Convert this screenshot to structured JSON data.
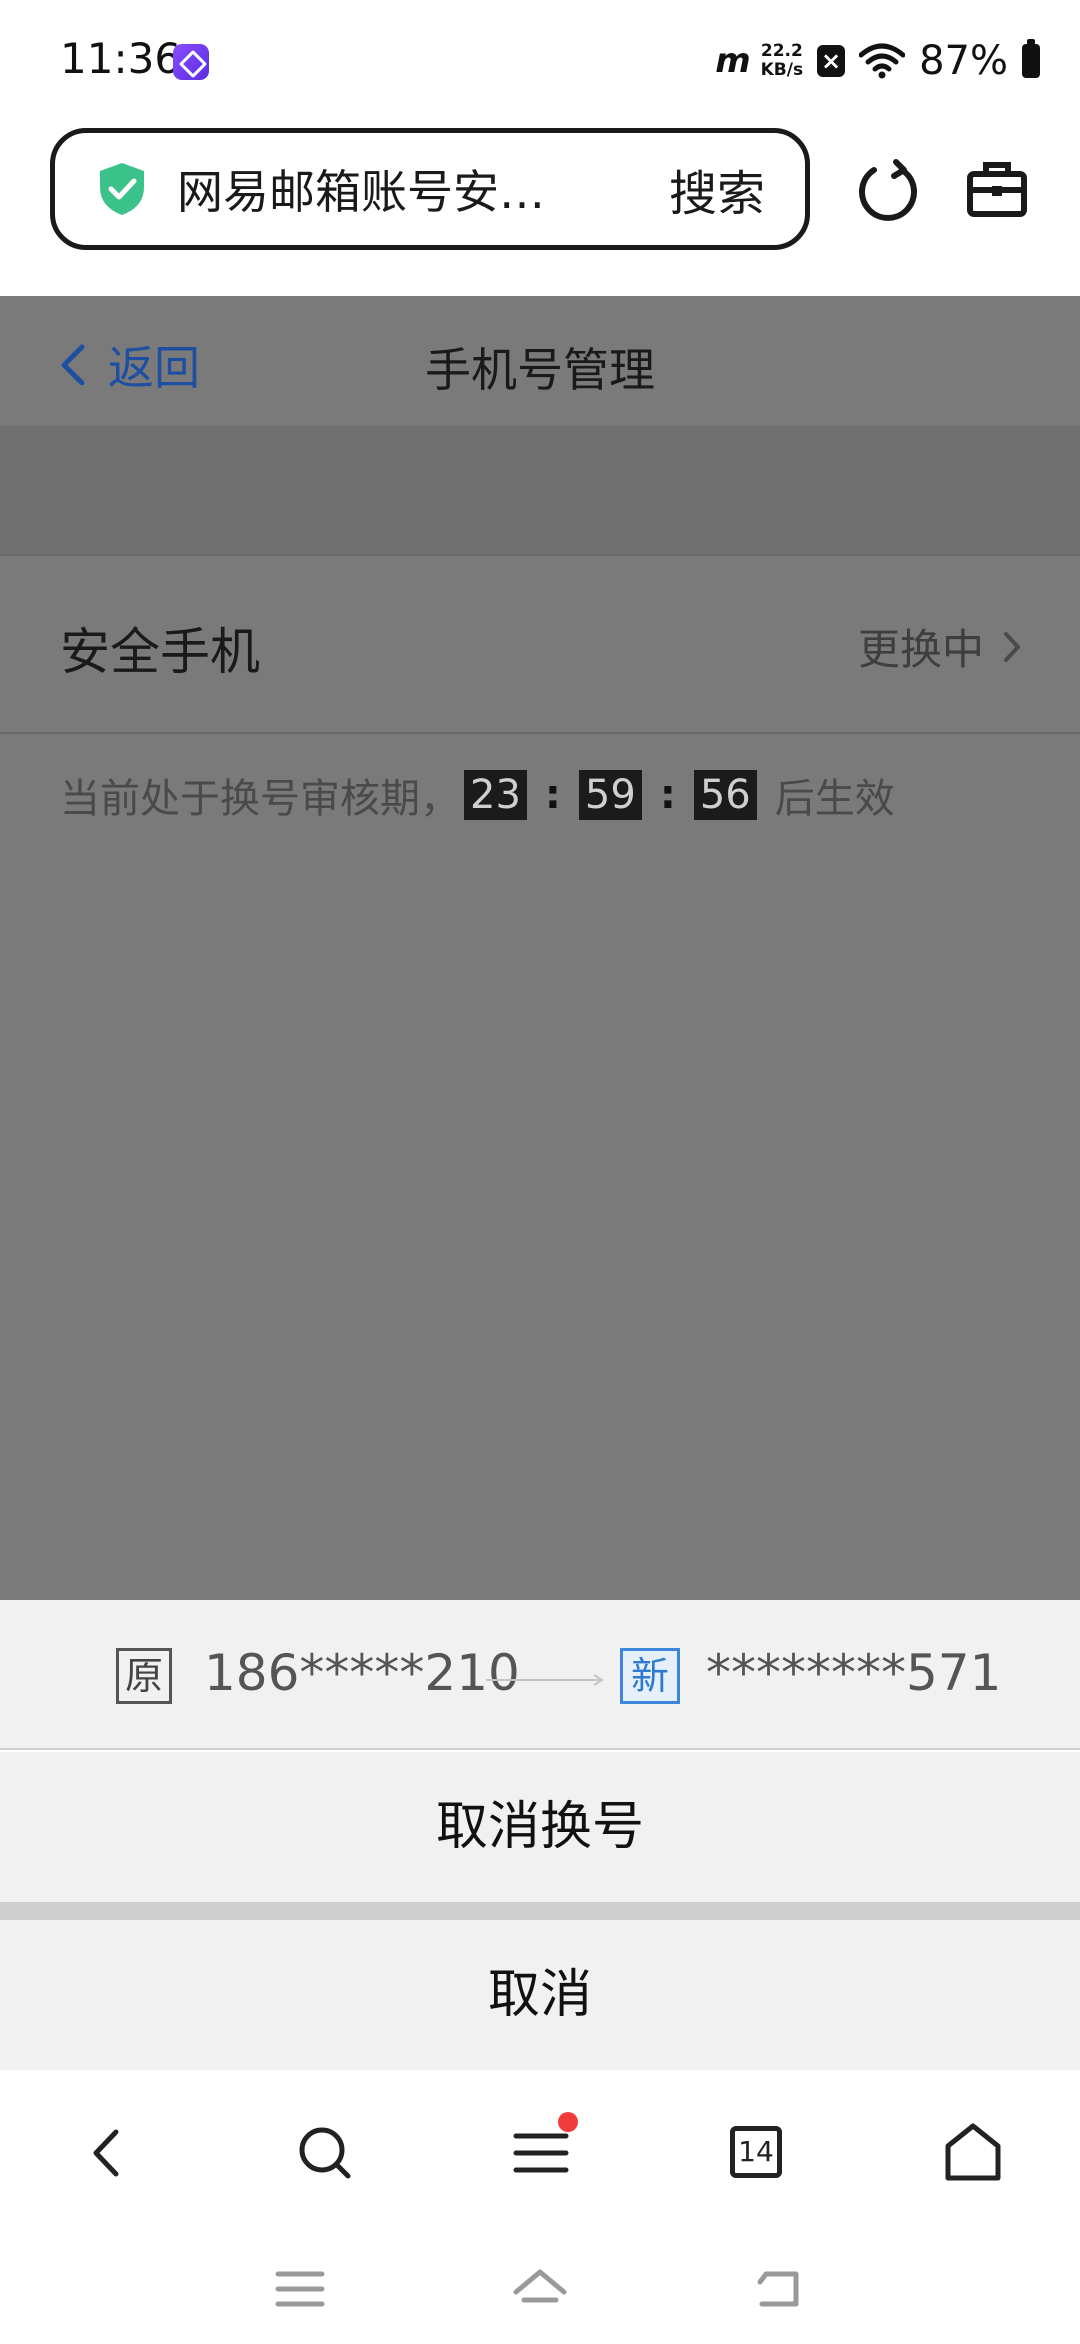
{
  "status_bar": {
    "time": "11:36",
    "speed_value": "22.2",
    "speed_unit": "KB/s",
    "battery": "87%"
  },
  "browser": {
    "url_text": "网易邮箱账号安…",
    "search_label": "搜索"
  },
  "page": {
    "back_label": "返回",
    "title": "手机号管理",
    "row_label": "安全手机",
    "row_status": "更换中",
    "notice_prefix": "当前处于换号审核期，",
    "timer": {
      "hours": "23",
      "minutes": "59",
      "seconds": "56"
    },
    "timer_separator": ":",
    "notice_suffix": "后生效"
  },
  "sheet": {
    "old_tag": "原",
    "old_number": "186*****210",
    "new_tag": "新",
    "new_number": "********571",
    "action_label": "取消换号",
    "cancel_label": "取消"
  },
  "toolbar": {
    "tabs_count": "14"
  },
  "colors": {
    "accent_blue": "#1f4fa0",
    "overlay_gray": "#7a7a7a",
    "shield_green": "#3bc28a",
    "notify_red": "#f03c3c"
  }
}
